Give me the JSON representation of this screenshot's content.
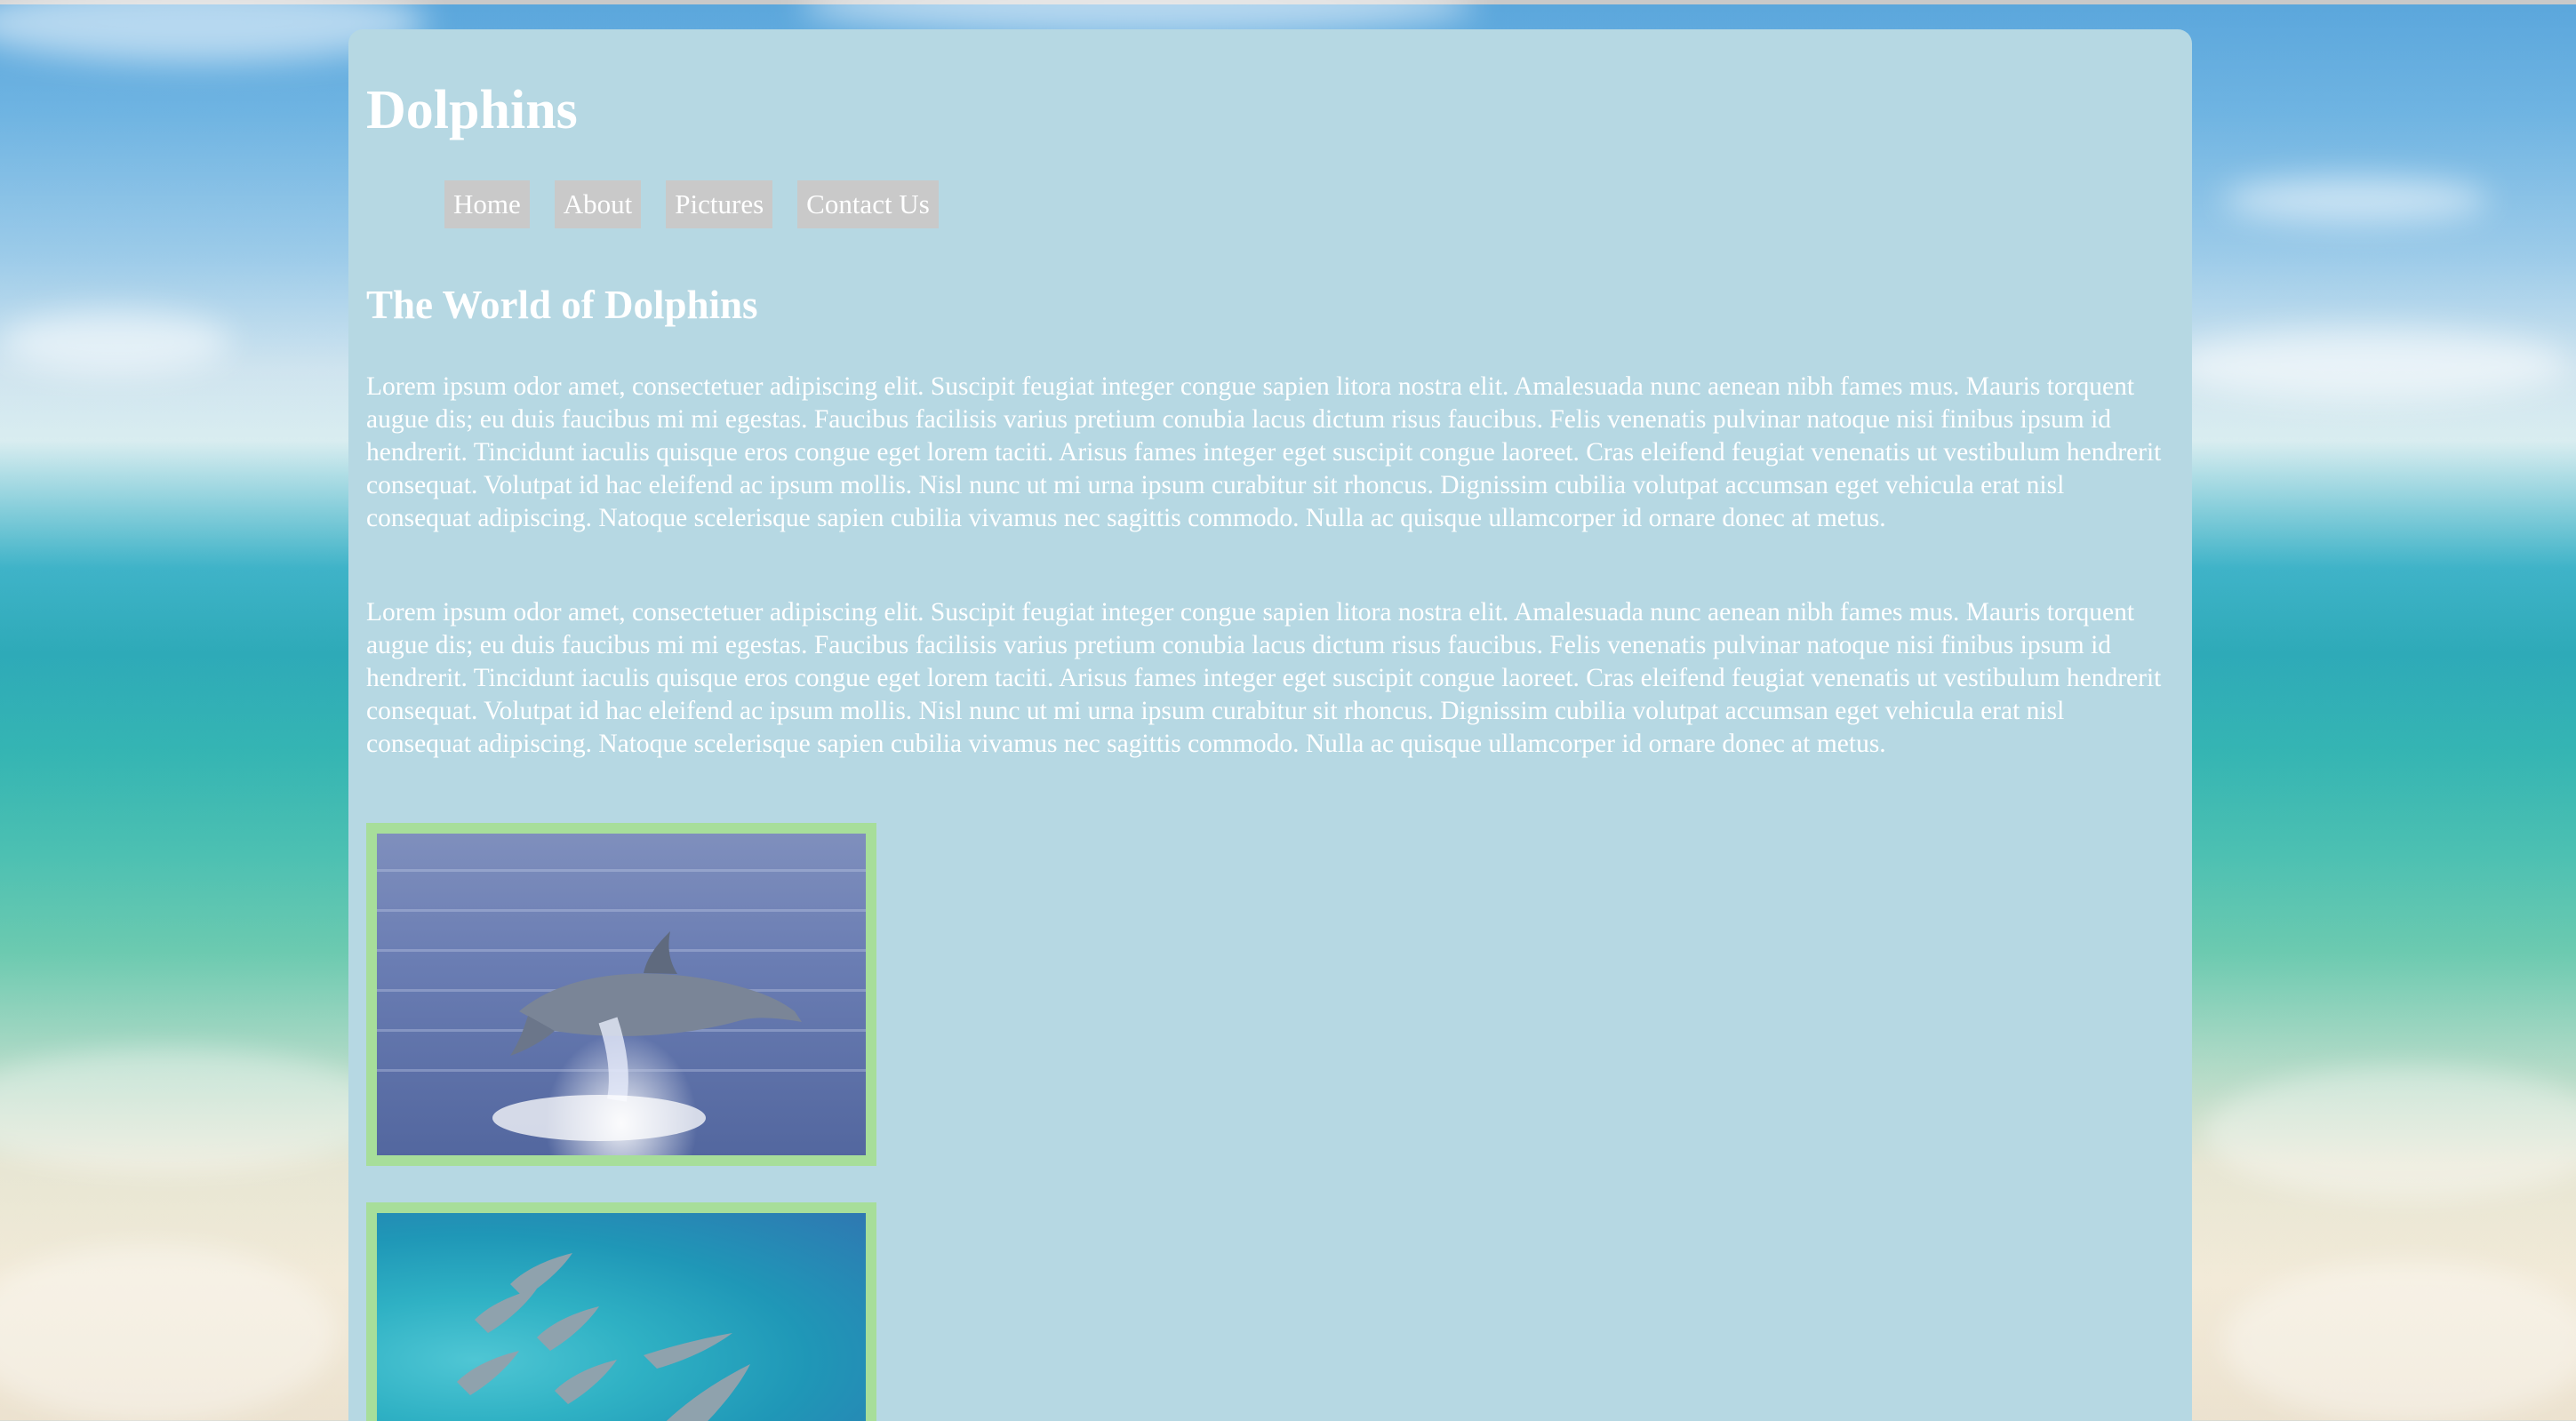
{
  "site": {
    "title": "Dolphins"
  },
  "nav": {
    "items": [
      {
        "label": "Home"
      },
      {
        "label": "About"
      },
      {
        "label": "Pictures"
      },
      {
        "label": "Contact Us"
      }
    ]
  },
  "main": {
    "heading": "The World of Dolphins",
    "paragraphs": [
      "Lorem ipsum odor amet, consectetuer adipiscing elit. Suscipit feugiat integer congue sapien litora nostra elit. Amalesuada nunc aenean nibh fames mus. Mauris torquent augue dis; eu duis faucibus mi mi egestas. Faucibus facilisis varius pretium conubia lacus dictum risus faucibus. Felis venenatis pulvinar natoque nisi finibus ipsum id hendrerit. Tincidunt iaculis quisque eros congue eget lorem taciti. Arisus fames integer eget suscipit congue laoreet. Cras eleifend feugiat venenatis ut vestibulum hendrerit consequat. Volutpat id hac eleifend ac ipsum mollis. Nisl nunc ut mi urna ipsum curabitur sit rhoncus. Dignissim cubilia volutpat accumsan eget vehicula erat nisl consequat adipiscing. Natoque scelerisque sapien cubilia vivamus nec sagittis commodo. Nulla ac quisque ullamcorper id ornare donec at metus.",
      "Lorem ipsum odor amet, consectetuer adipiscing elit. Suscipit feugiat integer congue sapien litora nostra elit. Amalesuada nunc aenean nibh fames mus. Mauris torquent augue dis; eu duis faucibus mi mi egestas. Faucibus facilisis varius pretium conubia lacus dictum risus faucibus. Felis venenatis pulvinar natoque nisi finibus ipsum id hendrerit. Tincidunt iaculis quisque eros congue eget lorem taciti. Arisus fames integer eget suscipit congue laoreet. Cras eleifend feugiat venenatis ut vestibulum hendrerit consequat. Volutpat id hac eleifend ac ipsum mollis. Nisl nunc ut mi urna ipsum curabitur sit rhoncus. Dignissim cubilia volutpat accumsan eget vehicula erat nisl consequat adipiscing. Natoque scelerisque sapien cubilia vivamus nec sagittis commodo. Nulla ac quisque ullamcorper id ornare donec at metus."
    ]
  },
  "gallery": {
    "images": [
      {
        "subject": "dolphin-leaping-photo"
      },
      {
        "subject": "dolphin-pod-photo"
      }
    ]
  },
  "colors": {
    "card_background": "#b6d8e3",
    "nav_button": "#c9c9c9",
    "photo_border": "#a7de9a",
    "text": "#ffffff"
  }
}
